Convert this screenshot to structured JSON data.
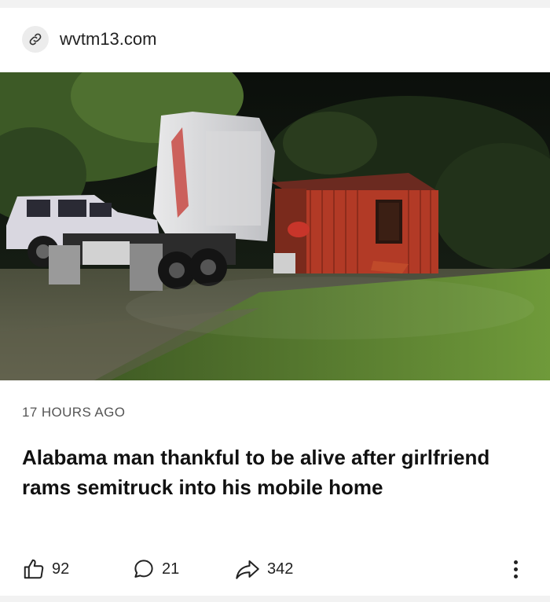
{
  "source": {
    "domain": "wvtm13.com",
    "icon": "link-icon"
  },
  "article": {
    "image_alt": "Semitruck cab crashed into a red mobile home at night with an SUV parked nearby",
    "timestamp": "17 HOURS AGO",
    "headline": "Alabama man thankful to be alive after girlfriend rams semitruck into his mobile home"
  },
  "actions": {
    "likes": {
      "icon": "thumbs-up-icon",
      "count": "92"
    },
    "comments": {
      "icon": "comment-icon",
      "count": "21"
    },
    "shares": {
      "icon": "share-icon",
      "count": "342"
    },
    "more": {
      "icon": "more-vertical-icon"
    }
  },
  "colors": {
    "background": "#f2f2f2",
    "card": "#ffffff",
    "text": "#111111",
    "muted": "#555555"
  }
}
